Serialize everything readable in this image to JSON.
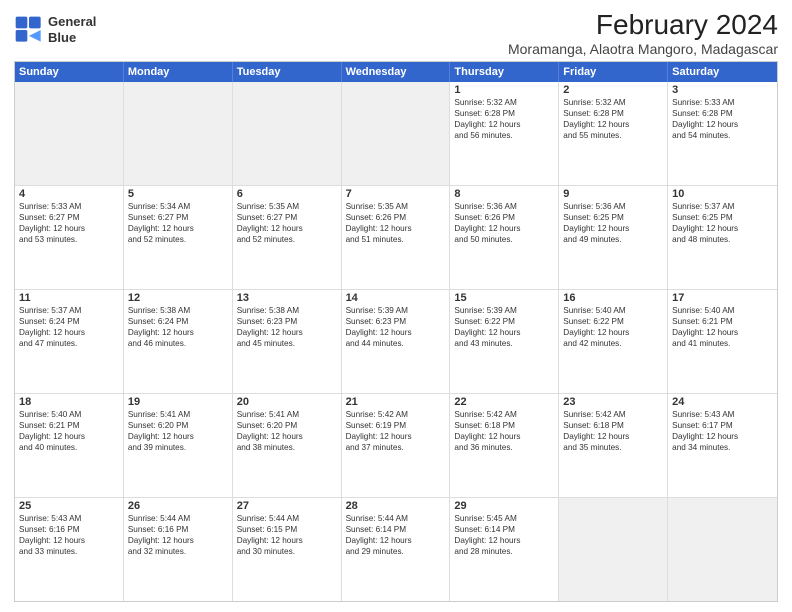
{
  "logo": {
    "line1": "General",
    "line2": "Blue"
  },
  "title": "February 2024",
  "subtitle": "Moramanga, Alaotra Mangoro, Madagascar",
  "header_days": [
    "Sunday",
    "Monday",
    "Tuesday",
    "Wednesday",
    "Thursday",
    "Friday",
    "Saturday"
  ],
  "rows": [
    [
      {
        "day": "",
        "text": "",
        "shaded": true
      },
      {
        "day": "",
        "text": "",
        "shaded": true
      },
      {
        "day": "",
        "text": "",
        "shaded": true
      },
      {
        "day": "",
        "text": "",
        "shaded": true
      },
      {
        "day": "1",
        "text": "Sunrise: 5:32 AM\nSunset: 6:28 PM\nDaylight: 12 hours\nand 56 minutes.",
        "shaded": false
      },
      {
        "day": "2",
        "text": "Sunrise: 5:32 AM\nSunset: 6:28 PM\nDaylight: 12 hours\nand 55 minutes.",
        "shaded": false
      },
      {
        "day": "3",
        "text": "Sunrise: 5:33 AM\nSunset: 6:28 PM\nDaylight: 12 hours\nand 54 minutes.",
        "shaded": false
      }
    ],
    [
      {
        "day": "4",
        "text": "Sunrise: 5:33 AM\nSunset: 6:27 PM\nDaylight: 12 hours\nand 53 minutes.",
        "shaded": false
      },
      {
        "day": "5",
        "text": "Sunrise: 5:34 AM\nSunset: 6:27 PM\nDaylight: 12 hours\nand 52 minutes.",
        "shaded": false
      },
      {
        "day": "6",
        "text": "Sunrise: 5:35 AM\nSunset: 6:27 PM\nDaylight: 12 hours\nand 52 minutes.",
        "shaded": false
      },
      {
        "day": "7",
        "text": "Sunrise: 5:35 AM\nSunset: 6:26 PM\nDaylight: 12 hours\nand 51 minutes.",
        "shaded": false
      },
      {
        "day": "8",
        "text": "Sunrise: 5:36 AM\nSunset: 6:26 PM\nDaylight: 12 hours\nand 50 minutes.",
        "shaded": false
      },
      {
        "day": "9",
        "text": "Sunrise: 5:36 AM\nSunset: 6:25 PM\nDaylight: 12 hours\nand 49 minutes.",
        "shaded": false
      },
      {
        "day": "10",
        "text": "Sunrise: 5:37 AM\nSunset: 6:25 PM\nDaylight: 12 hours\nand 48 minutes.",
        "shaded": false
      }
    ],
    [
      {
        "day": "11",
        "text": "Sunrise: 5:37 AM\nSunset: 6:24 PM\nDaylight: 12 hours\nand 47 minutes.",
        "shaded": false
      },
      {
        "day": "12",
        "text": "Sunrise: 5:38 AM\nSunset: 6:24 PM\nDaylight: 12 hours\nand 46 minutes.",
        "shaded": false
      },
      {
        "day": "13",
        "text": "Sunrise: 5:38 AM\nSunset: 6:23 PM\nDaylight: 12 hours\nand 45 minutes.",
        "shaded": false
      },
      {
        "day": "14",
        "text": "Sunrise: 5:39 AM\nSunset: 6:23 PM\nDaylight: 12 hours\nand 44 minutes.",
        "shaded": false
      },
      {
        "day": "15",
        "text": "Sunrise: 5:39 AM\nSunset: 6:22 PM\nDaylight: 12 hours\nand 43 minutes.",
        "shaded": false
      },
      {
        "day": "16",
        "text": "Sunrise: 5:40 AM\nSunset: 6:22 PM\nDaylight: 12 hours\nand 42 minutes.",
        "shaded": false
      },
      {
        "day": "17",
        "text": "Sunrise: 5:40 AM\nSunset: 6:21 PM\nDaylight: 12 hours\nand 41 minutes.",
        "shaded": false
      }
    ],
    [
      {
        "day": "18",
        "text": "Sunrise: 5:40 AM\nSunset: 6:21 PM\nDaylight: 12 hours\nand 40 minutes.",
        "shaded": false
      },
      {
        "day": "19",
        "text": "Sunrise: 5:41 AM\nSunset: 6:20 PM\nDaylight: 12 hours\nand 39 minutes.",
        "shaded": false
      },
      {
        "day": "20",
        "text": "Sunrise: 5:41 AM\nSunset: 6:20 PM\nDaylight: 12 hours\nand 38 minutes.",
        "shaded": false
      },
      {
        "day": "21",
        "text": "Sunrise: 5:42 AM\nSunset: 6:19 PM\nDaylight: 12 hours\nand 37 minutes.",
        "shaded": false
      },
      {
        "day": "22",
        "text": "Sunrise: 5:42 AM\nSunset: 6:18 PM\nDaylight: 12 hours\nand 36 minutes.",
        "shaded": false
      },
      {
        "day": "23",
        "text": "Sunrise: 5:42 AM\nSunset: 6:18 PM\nDaylight: 12 hours\nand 35 minutes.",
        "shaded": false
      },
      {
        "day": "24",
        "text": "Sunrise: 5:43 AM\nSunset: 6:17 PM\nDaylight: 12 hours\nand 34 minutes.",
        "shaded": false
      }
    ],
    [
      {
        "day": "25",
        "text": "Sunrise: 5:43 AM\nSunset: 6:16 PM\nDaylight: 12 hours\nand 33 minutes.",
        "shaded": false
      },
      {
        "day": "26",
        "text": "Sunrise: 5:44 AM\nSunset: 6:16 PM\nDaylight: 12 hours\nand 32 minutes.",
        "shaded": false
      },
      {
        "day": "27",
        "text": "Sunrise: 5:44 AM\nSunset: 6:15 PM\nDaylight: 12 hours\nand 30 minutes.",
        "shaded": false
      },
      {
        "day": "28",
        "text": "Sunrise: 5:44 AM\nSunset: 6:14 PM\nDaylight: 12 hours\nand 29 minutes.",
        "shaded": false
      },
      {
        "day": "29",
        "text": "Sunrise: 5:45 AM\nSunset: 6:14 PM\nDaylight: 12 hours\nand 28 minutes.",
        "shaded": false
      },
      {
        "day": "",
        "text": "",
        "shaded": true
      },
      {
        "day": "",
        "text": "",
        "shaded": true
      }
    ]
  ]
}
